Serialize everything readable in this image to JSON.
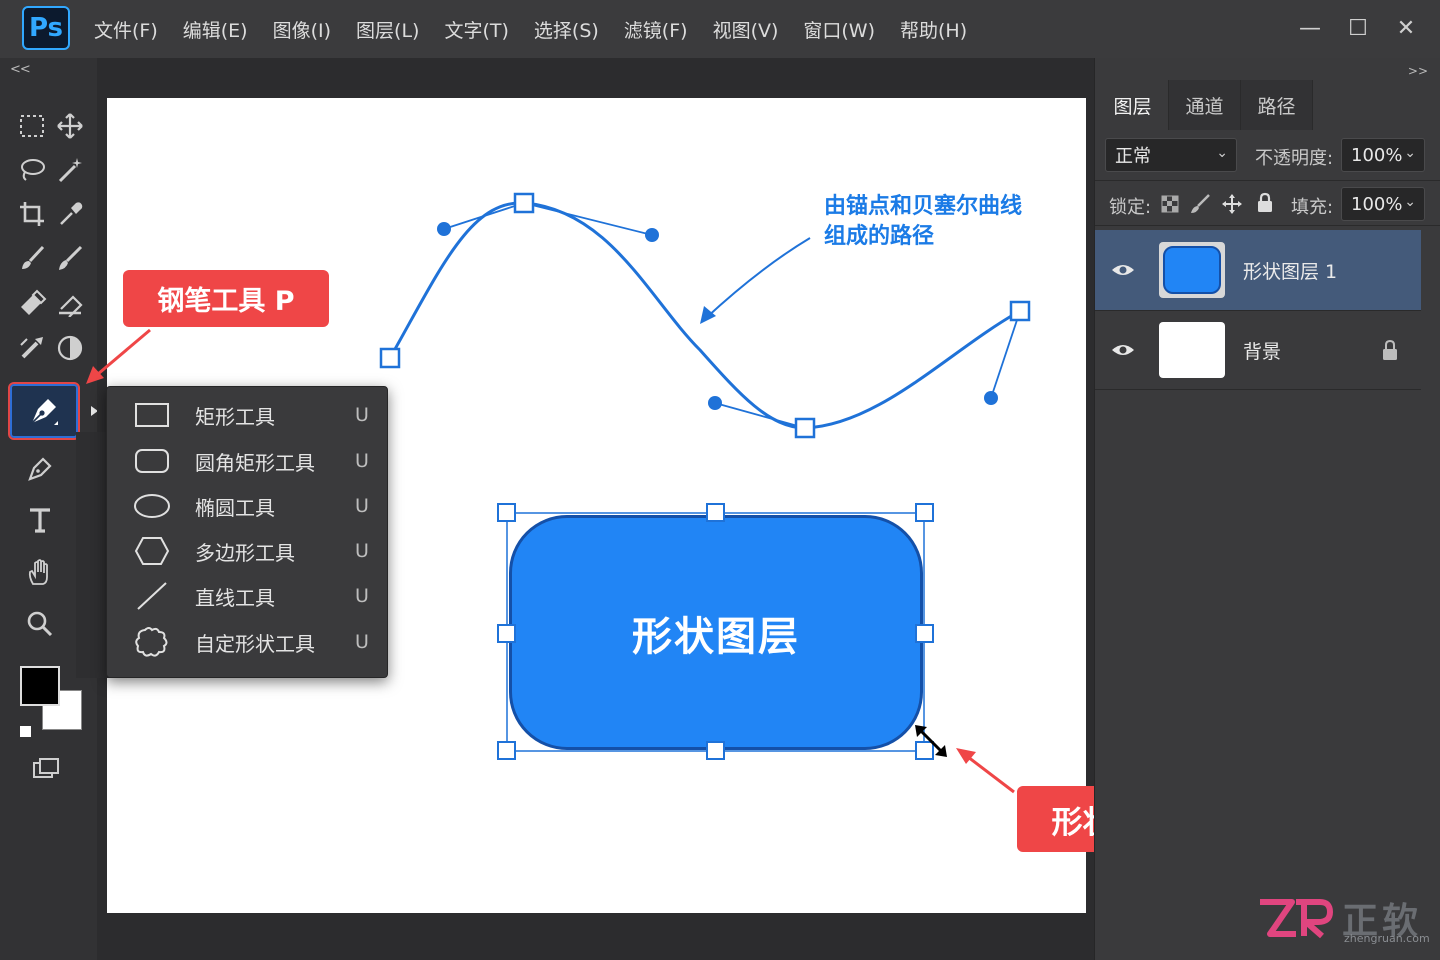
{
  "app": {
    "logo": "Ps",
    "menus": [
      "文件(F)",
      "编辑(E)",
      "图像(I)",
      "图层(L)",
      "文字(T)",
      "选择(S)",
      "滤镜(F)",
      "视图(V)",
      "窗口(W)",
      "帮助(H)"
    ],
    "window_controls": {
      "minimize": "—",
      "maximize": "☐",
      "close": "✕"
    }
  },
  "toolbar": {
    "collapse": "<<",
    "tools": [
      "marquee-icon",
      "move-icon",
      "lasso-icon",
      "magic-wand-icon",
      "crop-icon",
      "eyedropper-icon",
      "brush-icon",
      "pencil-icon",
      "eraser-icon",
      "bucket-icon",
      "gradient-icon",
      "dodge-icon",
      "pen-icon",
      "freeform-pen-icon",
      "type-icon",
      "hand-icon",
      "zoom-icon",
      "screen-mode-icon"
    ]
  },
  "shape_flyout": {
    "items": [
      {
        "label": "矩形工具",
        "key": "U",
        "icon": "rectangle-icon"
      },
      {
        "label": "圆角矩形工具",
        "key": "U",
        "icon": "rounded-rectangle-icon"
      },
      {
        "label": "椭圆工具",
        "key": "U",
        "icon": "ellipse-icon"
      },
      {
        "label": "多边形工具",
        "key": "U",
        "icon": "polygon-icon"
      },
      {
        "label": "直线工具",
        "key": "U",
        "icon": "line-icon"
      },
      {
        "label": "自定形状工具",
        "key": "U",
        "icon": "custom-shape-icon"
      }
    ]
  },
  "callouts": {
    "pen_tool": "钢笔工具 P",
    "bezier_line1": "由锚点和贝塞尔曲线",
    "bezier_line2": "组成的路径",
    "shape_layer_text": "形状图层",
    "scaling": "形状图层可无损缩放"
  },
  "layers_panel": {
    "collapse": ">>",
    "tabs": [
      "图层",
      "通道",
      "路径"
    ],
    "blend_mode": "正常",
    "opacity_label": "不透明度:",
    "opacity": "100%",
    "lock_label": "锁定:",
    "fill_label": "填充:",
    "fill": "100%",
    "layers": [
      {
        "name": "形状图层 1",
        "selected": true,
        "thumb_color": "#2185f5"
      },
      {
        "name": "背景",
        "selected": false,
        "locked": true,
        "thumb_color": "#ffffff"
      }
    ]
  },
  "colors": {
    "accent_blue": "#2185f5",
    "path_blue": "#1f72d8",
    "callout_red": "#ef4647",
    "foreground": "#000000",
    "background": "#ffffff"
  },
  "watermark": {
    "brand": "正软",
    "url": "zhengruan.com"
  }
}
